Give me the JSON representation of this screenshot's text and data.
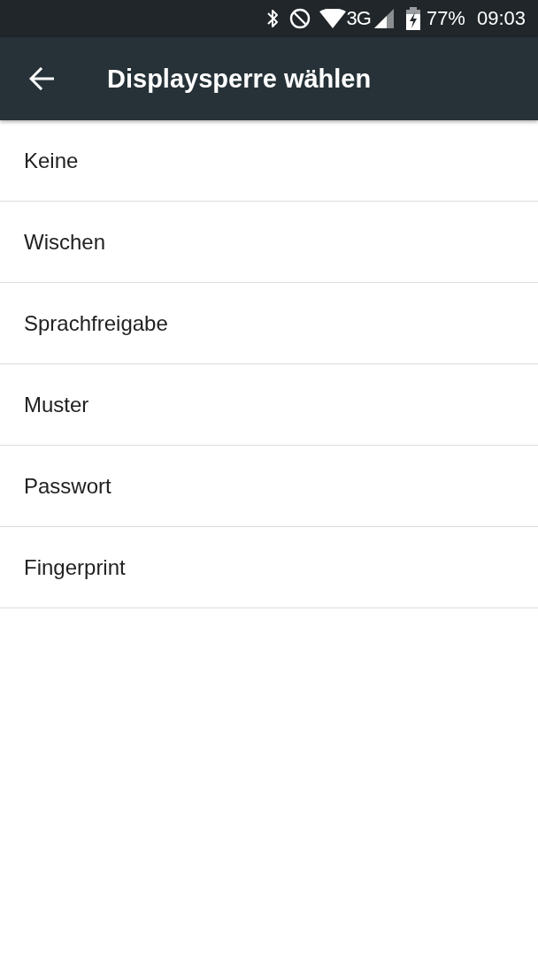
{
  "status_bar": {
    "network": "3G",
    "battery": "77%",
    "time": "09:03"
  },
  "app_bar": {
    "title": "Displaysperre wählen"
  },
  "items": [
    {
      "label": "Keine"
    },
    {
      "label": "Wischen"
    },
    {
      "label": "Sprachfreigabe"
    },
    {
      "label": "Muster"
    },
    {
      "label": "Passwort"
    },
    {
      "label": "Fingerprint"
    }
  ]
}
